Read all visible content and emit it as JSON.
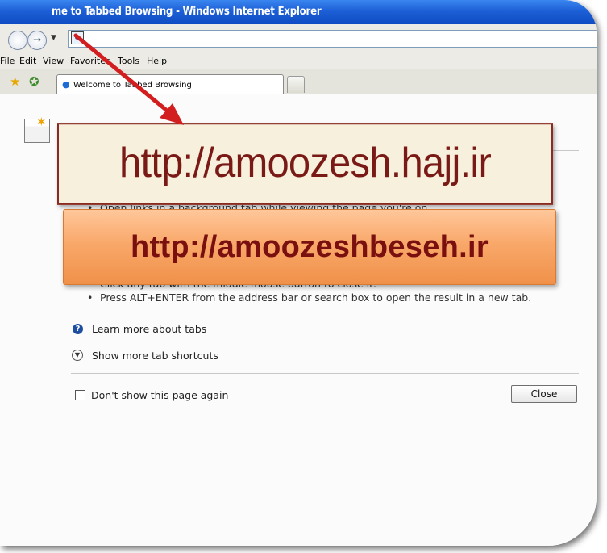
{
  "window": {
    "title": "me to Tabbed Browsing - Windows Internet Explorer"
  },
  "menu": [
    "File",
    "Edit",
    "View",
    "Favorites",
    "Tools",
    "Help"
  ],
  "tab": {
    "label": "Welcome to Tabbed Browsing"
  },
  "tips": [
    "Open links in a background tab while viewing the page you're on.",
    "Click any tab with the middle mouse button to close it.",
    "Press ALT+ENTER from the address bar or search box to open the result in a new tab."
  ],
  "links": {
    "learn_more": "Learn more about tabs",
    "show_more": "Show more tab shortcuts"
  },
  "checkbox_label": "Don't show this page again",
  "close_label": "Close",
  "banners": {
    "primary": "http://amoozesh.hajj.ir",
    "secondary": "http://amoozeshbeseh.ir"
  },
  "colors": {
    "title_bar": "#1d5fd6",
    "banner_text": "#7a1a16",
    "banner_orange": "#f9a86a",
    "arrow": "#d21e1e"
  }
}
